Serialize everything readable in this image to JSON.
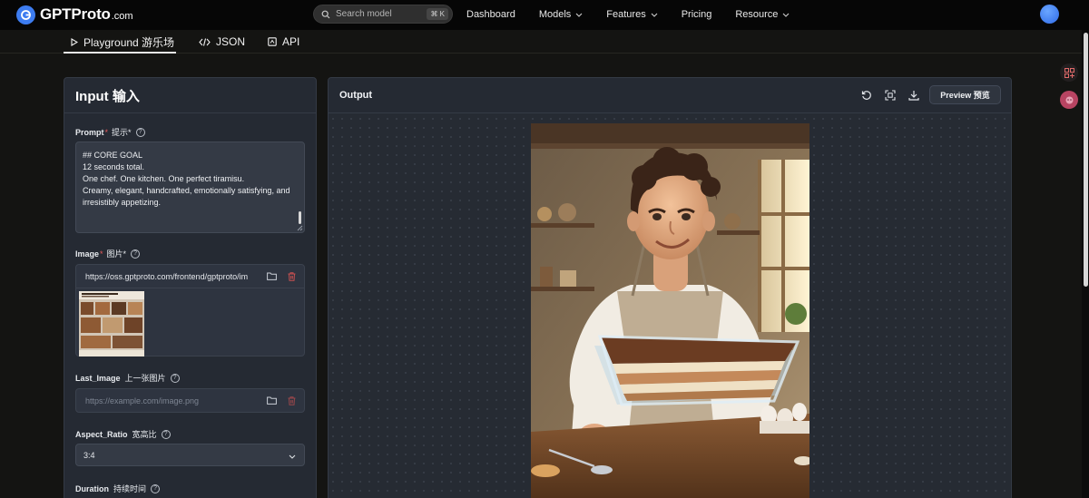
{
  "brand": {
    "name": "GPTProto",
    "suffix": ".com"
  },
  "search": {
    "placeholder": "Search model",
    "shortcut": "⌘ K"
  },
  "nav": {
    "items": [
      {
        "label": "Dashboard",
        "has_menu": false
      },
      {
        "label": "Models",
        "has_menu": true
      },
      {
        "label": "Features",
        "has_menu": true
      },
      {
        "label": "Pricing",
        "has_menu": false
      },
      {
        "label": "Resource",
        "has_menu": true
      }
    ]
  },
  "tabs": [
    {
      "label": "Playground  游乐场",
      "icon": "play-icon",
      "active": true
    },
    {
      "label": "JSON",
      "icon": "code-icon",
      "active": false
    },
    {
      "label": "API",
      "icon": "api-icon",
      "active": false
    }
  ],
  "input_panel": {
    "title": "Input  输入",
    "prompt": {
      "label": "Prompt",
      "label_cn": "提示*",
      "required": "*",
      "lines": [
        "## CORE GOAL",
        "",
        "12 seconds total.",
        "One chef. One kitchen. One perfect tiramisu.",
        "Creamy, elegant, handcrafted, emotionally satisfying, and irresistibly appetizing."
      ]
    },
    "image": {
      "label": "Image",
      "label_cn": "图片*",
      "required": "*",
      "value": "https://oss.gptproto.com/frontend/gptproto/im"
    },
    "last_image": {
      "label": "Last_Image",
      "label_cn": "上一张图片",
      "placeholder": "https://example.com/image.png"
    },
    "aspect_ratio": {
      "label": "Aspect_Ratio",
      "label_cn": "宽高比",
      "value": "3:4"
    },
    "duration": {
      "label": "Duration",
      "label_cn": "持续时间"
    }
  },
  "output_panel": {
    "title": "Output",
    "preview_label": "Preview  预览",
    "icons": [
      "refresh-icon",
      "fit-screen-icon",
      "download-icon"
    ]
  },
  "colors": {
    "accent": "#3d7cf0",
    "panel": "#252a33",
    "required": "#e85a5a",
    "delete": "#c85050"
  }
}
